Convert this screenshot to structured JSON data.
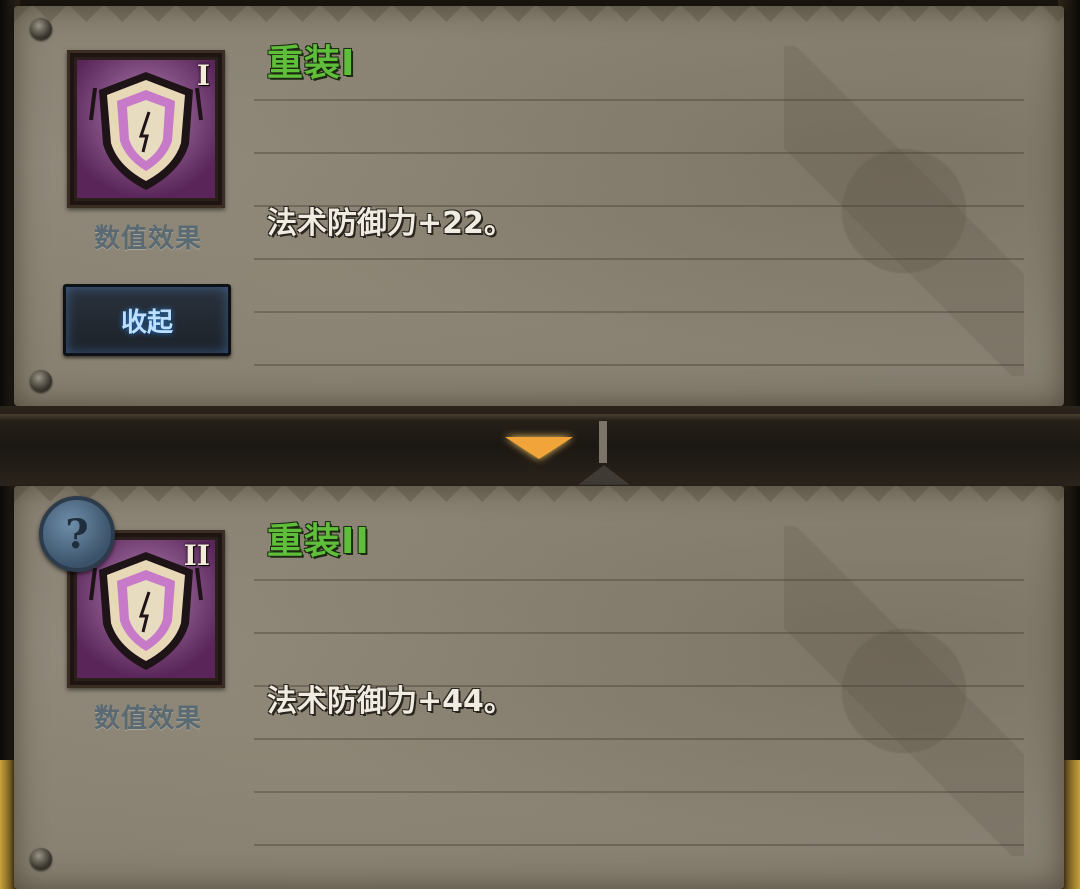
{
  "entries": [
    {
      "title": "重装I",
      "rank_numeral": "I",
      "caption": "数值效果",
      "effect": "法术防御力+22。",
      "icon": "shield-icon"
    },
    {
      "title": "重装II",
      "rank_numeral": "II",
      "caption": "数值效果",
      "effect": "法术防御力+44。",
      "icon": "shield-icon"
    }
  ],
  "collapse_button": {
    "label": "收起"
  },
  "help_button": {
    "label": "?"
  },
  "colors": {
    "title_green": "#5fbf3a",
    "icon_purple": "#8a3b8a",
    "arrow_orange": "#f0a43a",
    "button_blue_glow": "#2d7fd0"
  }
}
